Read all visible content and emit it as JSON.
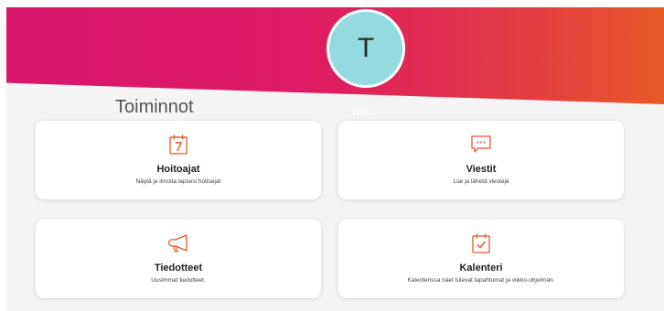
{
  "profile": {
    "avatar_initial": "T",
    "name": "Test"
  },
  "section": {
    "title": "Toiminnot"
  },
  "cards": [
    {
      "title": "Hoitoajat",
      "description": "Näytä ja ilmoita lapsesi hoitoajat",
      "icon": "calendar-7-icon"
    },
    {
      "title": "Viestit",
      "description": "Lue ja lähetä viestejä",
      "icon": "message-bubble-icon"
    },
    {
      "title": "Tiedotteet",
      "description": "Uusimmat tiedotteet.",
      "icon": "megaphone-icon"
    },
    {
      "title": "Kalenteri",
      "description": "Kalenterissa näet tulevat tapahtumat ja viikko-ohjelman.",
      "icon": "calendar-check-icon"
    }
  ],
  "colors": {
    "accent": "#e4572e",
    "hero_start": "#d8166a",
    "hero_end": "#e65a27",
    "avatar_bg": "#93dbe0"
  }
}
